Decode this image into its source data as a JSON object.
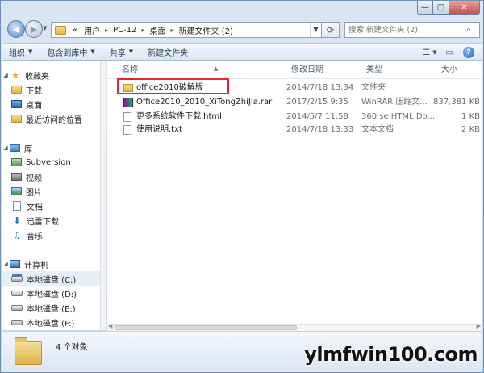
{
  "window": {
    "caption_minimize": "—",
    "caption_maximize": "□",
    "caption_close": "✕"
  },
  "address": {
    "crumbs": [
      "«",
      "用户",
      "PC-12",
      "桌面",
      "新建文件夹 (2)"
    ],
    "separator": "▸",
    "search_placeholder": "搜索 新建文件夹 (2)"
  },
  "toolbar": {
    "organize": "组织",
    "include_library": "包含到库中",
    "share": "共享",
    "new_folder": "新建文件夹"
  },
  "nav": {
    "favorites": "收藏夹",
    "downloads": "下载",
    "desktop": "桌面",
    "recent": "最近访问的位置",
    "libraries": "库",
    "subversion": "Subversion",
    "videos": "视频",
    "pictures": "图片",
    "documents": "文档",
    "xunlei": "迅雷下载",
    "music": "音乐",
    "computer": "计算机",
    "drive_c": "本地磁盘 (C:)",
    "drive_d": "本地磁盘 (D:)",
    "drive_e": "本地磁盘 (E:)",
    "drive_f": "本地磁盘 (F:)"
  },
  "columns": {
    "name": "名称",
    "date": "修改日期",
    "type": "类型",
    "size": "大小"
  },
  "files": [
    {
      "name": "office2010破解版",
      "date": "2014/7/18 13:34",
      "type": "文件夹",
      "size": ""
    },
    {
      "name": "Office2010_2010_XiTongZhiJia.rar",
      "date": "2017/2/15 9:35",
      "type": "WinRAR 压缩文...",
      "size": "837,381 KB"
    },
    {
      "name": "更多系统软件下载.html",
      "date": "2014/5/7 11:58",
      "type": "360 se HTML Do...",
      "size": "1 KB"
    },
    {
      "name": "使用说明.txt",
      "date": "2014/7/18 13:33",
      "type": "文本文档",
      "size": "2 KB"
    }
  ],
  "status": {
    "count": "4 个对象"
  },
  "watermark": "ylmfwin100.com",
  "colors": {
    "highlight_box": "#e8232a",
    "selected_nav": "#e5eef9"
  }
}
